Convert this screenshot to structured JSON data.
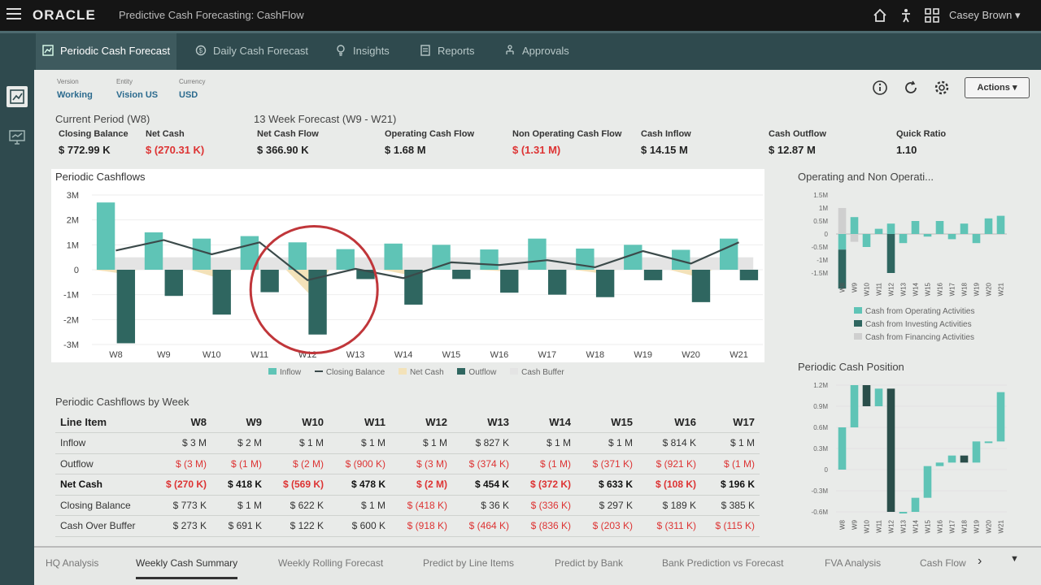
{
  "app": {
    "brand": "ORACLE",
    "title": "Predictive Cash Forecasting: CashFlow",
    "user": "Casey Brown"
  },
  "nav": {
    "tabs": [
      {
        "label": "Periodic Cash Forecast",
        "icon": "forecast-icon",
        "active": true
      },
      {
        "label": "Daily Cash Forecast",
        "icon": "daily-icon"
      },
      {
        "label": "Insights",
        "icon": "insights-icon"
      },
      {
        "label": "Reports",
        "icon": "reports-icon"
      },
      {
        "label": "Approvals",
        "icon": "approvals-icon"
      }
    ]
  },
  "pov": [
    {
      "label": "Version",
      "value": "Working"
    },
    {
      "label": "Entity",
      "value": "Vision US"
    },
    {
      "label": "Currency",
      "value": "USD"
    }
  ],
  "actions_label": "Actions",
  "current_period": {
    "title": "Current Period (W8)",
    "closing_label": "Closing Balance",
    "closing_value": "$ 772.99 K",
    "net_label": "Net Cash",
    "net_value": "$ (270.31 K)"
  },
  "forecast": {
    "title": "13 Week Forecast (W9 - W21)",
    "kpis": [
      {
        "label": "Net Cash Flow",
        "value": "$ 366.90 K",
        "neg": false
      },
      {
        "label": "Operating Cash Flow",
        "value": "$ 1.68 M",
        "neg": false
      },
      {
        "label": "Non Operating Cash Flow",
        "value": "$ (1.31 M)",
        "neg": true
      },
      {
        "label": "Cash Inflow",
        "value": "$ 14.15 M",
        "neg": false
      },
      {
        "label": "Cash Outflow",
        "value": "$ 12.87 M",
        "neg": false
      },
      {
        "label": "Quick Ratio",
        "value": "1.10",
        "neg": false
      }
    ]
  },
  "colors": {
    "inflow": "#5fc4b6",
    "outflow": "#2f6660",
    "net": "#f3e2b9",
    "buffer": "#e4e4e4",
    "closing": "#3b4a4a",
    "negative": "#dd3333",
    "circle": "#c0363a"
  },
  "chart_data": [
    {
      "type": "bar",
      "title": "Periodic Cashflows",
      "categories": [
        "W8",
        "W9",
        "W10",
        "W11",
        "W12",
        "W13",
        "W14",
        "W15",
        "W16",
        "W17",
        "W18",
        "W19",
        "W20",
        "W21"
      ],
      "ylim": [
        -3000000,
        3000000
      ],
      "yticks": [
        "3M",
        "2M",
        "1M",
        "0",
        "-1M",
        "-2M",
        "-3M"
      ],
      "series": [
        {
          "name": "Inflow",
          "values": [
            2700000,
            1500000,
            1250000,
            1350000,
            1100000,
            827000,
            1050000,
            1000000,
            814000,
            1250000,
            850000,
            1000000,
            800000,
            1250000
          ]
        },
        {
          "name": "Outflow",
          "values": [
            -2950000,
            -1050000,
            -1800000,
            -900000,
            -2600000,
            -374000,
            -1400000,
            -371000,
            -921000,
            -1000000,
            -1100000,
            -420000,
            -1300000,
            -420000
          ]
        },
        {
          "name": "Net Cash",
          "values": [
            -270000,
            418000,
            -569000,
            478000,
            -2000000,
            454000,
            -372000,
            633000,
            -108000,
            196000,
            -250000,
            580000,
            -500000,
            830000
          ]
        },
        {
          "name": "Closing Balance",
          "values": [
            773000,
            1191000,
            622000,
            1100000,
            -418000,
            36000,
            -336000,
            297000,
            189000,
            385000,
            100000,
            750000,
            250000,
            1100000
          ]
        },
        {
          "name": "Cash Buffer",
          "values": [
            500000,
            500000,
            500000,
            500000,
            500000,
            500000,
            500000,
            500000,
            500000,
            500000,
            500000,
            500000,
            500000,
            500000
          ]
        }
      ]
    },
    {
      "type": "bar",
      "title": "Operating and Non Operati...",
      "categories": [
        "W8",
        "W9",
        "W10",
        "W11",
        "W12",
        "W13",
        "W14",
        "W15",
        "W16",
        "W17",
        "W18",
        "W19",
        "W20",
        "W21"
      ],
      "yticks": [
        "1.5M",
        "1M",
        "0.5M",
        "0",
        "-0.5M",
        "-1M",
        "-1.5M"
      ],
      "series": [
        {
          "name": "Cash from Operating Activities",
          "values": [
            -0.6,
            0.65,
            -0.5,
            0.2,
            0.4,
            -0.35,
            0.5,
            -0.1,
            0.5,
            -0.2,
            0.4,
            -0.35,
            0.6,
            0.7
          ]
        },
        {
          "name": "Cash from Investing Activities",
          "values": [
            -1.5,
            0,
            0,
            0,
            -1.5,
            0,
            0,
            0,
            0,
            0,
            0,
            0,
            0,
            0
          ]
        },
        {
          "name": "Cash from Financing Activities",
          "values": [
            1.0,
            -0.3,
            0,
            0,
            0,
            0,
            0,
            0,
            0,
            0,
            0,
            0,
            0,
            0
          ]
        }
      ]
    },
    {
      "type": "bar",
      "title": "Periodic Cash Position",
      "categories": [
        "W8",
        "W9",
        "W10",
        "W11",
        "W12",
        "W13",
        "W14",
        "W15",
        "W16",
        "W17",
        "W18",
        "W19",
        "W20",
        "W21"
      ],
      "yticks": [
        "1.2M",
        "0.9M",
        "0.6M",
        "0.3M",
        "0",
        "-0.3M",
        "-0.6M"
      ],
      "series": [
        {
          "name": "Closing Balance",
          "values": [
            0.6,
            1.2,
            0.9,
            1.15,
            -0.6,
            -0.6,
            -0.4,
            0.05,
            0.1,
            0.2,
            0.1,
            0.4,
            0.4,
            1.1
          ]
        }
      ]
    }
  ],
  "table": {
    "title": "Periodic Cashflows by Week",
    "columns": [
      "Line Item",
      "W8",
      "W9",
      "W10",
      "W11",
      "W12",
      "W13",
      "W14",
      "W15",
      "W16",
      "W17"
    ],
    "rows": [
      {
        "label": "Inflow",
        "bold": false,
        "cells": [
          "$ 3 M",
          "$ 2 M",
          "$ 1 M",
          "$ 1 M",
          "$ 1 M",
          "$ 827 K",
          "$ 1 M",
          "$ 1 M",
          "$ 814 K",
          "$ 1 M"
        ]
      },
      {
        "label": "Outflow",
        "bold": false,
        "cells": [
          "$ (3 M)",
          "$ (1 M)",
          "$ (2 M)",
          "$ (900 K)",
          "$ (3 M)",
          "$ (374 K)",
          "$ (1 M)",
          "$ (371 K)",
          "$ (921 K)",
          "$ (1 M)"
        ]
      },
      {
        "label": "Net Cash",
        "bold": true,
        "cells": [
          "$ (270 K)",
          "$ 418 K",
          "$ (569 K)",
          "$ 478 K",
          "$ (2 M)",
          "$ 454 K",
          "$ (372 K)",
          "$ 633 K",
          "$ (108 K)",
          "$ 196 K"
        ]
      },
      {
        "label": "Closing Balance",
        "bold": false,
        "cells": [
          "$ 773 K",
          "$ 1 M",
          "$ 622 K",
          "$ 1 M",
          "$ (418 K)",
          "$ 36 K",
          "$ (336 K)",
          "$ 297 K",
          "$ 189 K",
          "$ 385 K"
        ]
      },
      {
        "label": "Cash Over Buffer",
        "bold": false,
        "cells": [
          "$ 273 K",
          "$ 691 K",
          "$ 122 K",
          "$ 600 K",
          "$ (918 K)",
          "$ (464 K)",
          "$ (836 K)",
          "$ (203 K)",
          "$ (311 K)",
          "$ (115 K)"
        ]
      }
    ]
  },
  "bottom_tabs": [
    "HQ Analysis",
    "Weekly Cash Summary",
    "Weekly Rolling Forecast",
    "Predict by Line Items",
    "Predict by Bank",
    "Bank Prediction vs Forecast",
    "FVA Analysis",
    "Cash Flow"
  ],
  "bottom_active": 1
}
